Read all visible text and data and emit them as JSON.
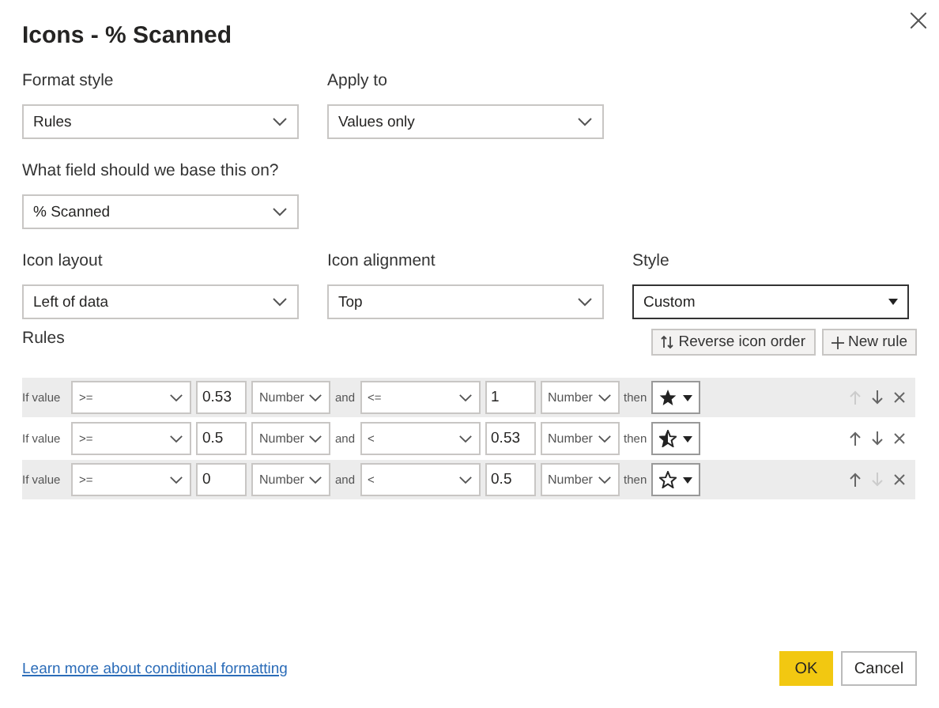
{
  "dialog": {
    "title": "Icons - % Scanned"
  },
  "row_1": [
    {
      "label": "Format style",
      "value": "Rules",
      "focused": false
    },
    {
      "label": "Apply to",
      "value": "Values only",
      "focused": false
    }
  ],
  "base_field": {
    "label": "What field should we base this on?",
    "value": "% Scanned",
    "focused": false
  },
  "row_2": [
    {
      "label": "Icon layout",
      "value": "Left of data",
      "focused": false
    },
    {
      "label": "Icon alignment",
      "value": "Top",
      "focused": false
    },
    {
      "label": "Style",
      "value": "Custom",
      "focused": true
    }
  ],
  "rules_label": "Rules",
  "rule_buttons": [
    {
      "kind": "reverse",
      "label": "Reverse icon order"
    },
    {
      "kind": "add",
      "label": "New rule"
    }
  ],
  "rules": [
    {
      "label": "If value",
      "op1": ">=",
      "value1": "0.53",
      "type1": "Number",
      "joiner": "and",
      "op2": "<=",
      "value2": "1",
      "type2": "Number",
      "then": "then",
      "kind": "full",
      "up_enabled": false,
      "down_enabled": true
    },
    {
      "label": "If value",
      "op1": ">=",
      "value1": "0.5",
      "type1": "Number",
      "joiner": "and",
      "op2": "<",
      "value2": "0.53",
      "type2": "Number",
      "then": "then",
      "kind": "half",
      "up_enabled": true,
      "down_enabled": true
    },
    {
      "label": "If value",
      "op1": ">=",
      "value1": "0",
      "type1": "Number",
      "joiner": "and",
      "op2": "<",
      "value2": "0.5",
      "type2": "Number",
      "then": "then",
      "kind": "empty",
      "up_enabled": true,
      "down_enabled": false
    }
  ],
  "footer": {
    "link": "Learn more about conditional formatting",
    "ok": "OK",
    "cancel": "Cancel"
  }
}
